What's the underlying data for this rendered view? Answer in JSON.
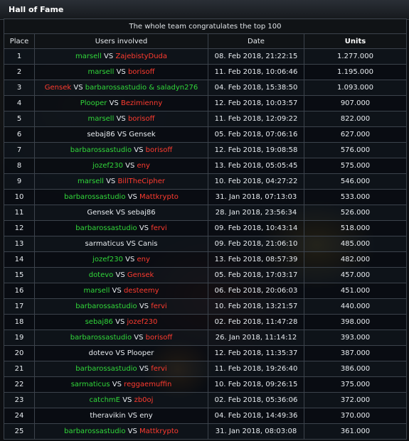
{
  "title": "Hall of Fame",
  "congrats": "The whole team congratulates the top 100",
  "columns": {
    "place": "Place",
    "users": "Users involved",
    "date": "Date",
    "units": "Units"
  },
  "colors": {
    "green": "#31d83a",
    "red": "#ff3b2f",
    "white": "#e8ecf0"
  },
  "vs": "VS",
  "rows": [
    {
      "place": "1",
      "a": "marsell",
      "ac": "p1",
      "b": "ZajebistyDuda",
      "bc": "p2",
      "date": "08. Feb 2018, 21:22:15",
      "units": "1.277.000"
    },
    {
      "place": "2",
      "a": "marsell",
      "ac": "p1",
      "b": "borisoff",
      "bc": "p2",
      "date": "11. Feb 2018, 10:06:46",
      "units": "1.195.000"
    },
    {
      "place": "3",
      "a": "Gensek",
      "ac": "p2",
      "b": "barbarossastudio & saladyn276",
      "bc": "p1",
      "date": "04. Feb 2018, 15:38:50",
      "units": "1.093.000"
    },
    {
      "place": "4",
      "a": "Plooper",
      "ac": "p1",
      "b": "Bezimienny",
      "bc": "p2",
      "date": "12. Feb 2018, 10:03:57",
      "units": "907.000"
    },
    {
      "place": "5",
      "a": "marsell",
      "ac": "p1",
      "b": "borisoff",
      "bc": "p2",
      "date": "11. Feb 2018, 12:09:22",
      "units": "822.000"
    },
    {
      "place": "6",
      "a": "sebaj86",
      "ac": "w",
      "b": "Gensek",
      "bc": "w",
      "date": "05. Feb 2018, 07:06:16",
      "units": "627.000"
    },
    {
      "place": "7",
      "a": "barbarossastudio",
      "ac": "p1",
      "b": "borisoff",
      "bc": "p2",
      "date": "12. Feb 2018, 19:08:58",
      "units": "576.000"
    },
    {
      "place": "8",
      "a": "jozef230",
      "ac": "p1",
      "b": "eny",
      "bc": "p2",
      "date": "13. Feb 2018, 05:05:45",
      "units": "575.000"
    },
    {
      "place": "9",
      "a": "marsell",
      "ac": "p1",
      "b": "BillTheCipher",
      "bc": "p2",
      "date": "10. Feb 2018, 04:27:22",
      "units": "546.000"
    },
    {
      "place": "10",
      "a": "barbarossastudio",
      "ac": "p1",
      "b": "Mattkrypto",
      "bc": "p2",
      "date": "31. Jan 2018, 07:13:03",
      "units": "533.000"
    },
    {
      "place": "11",
      "a": "Gensek",
      "ac": "w",
      "b": "sebaj86",
      "bc": "w",
      "date": "28. Jan 2018, 23:56:34",
      "units": "526.000"
    },
    {
      "place": "12",
      "a": "barbarossastudio",
      "ac": "p1",
      "b": "fervi",
      "bc": "p2",
      "date": "09. Feb 2018, 10:43:14",
      "units": "518.000"
    },
    {
      "place": "13",
      "a": "sarmaticus",
      "ac": "w",
      "b": "Canis",
      "bc": "w",
      "date": "09. Feb 2018, 21:06:10",
      "units": "485.000"
    },
    {
      "place": "14",
      "a": "jozef230",
      "ac": "p1",
      "b": "eny",
      "bc": "p2",
      "date": "13. Feb 2018, 08:57:39",
      "units": "482.000"
    },
    {
      "place": "15",
      "a": "dotevo",
      "ac": "p1",
      "b": "Gensek",
      "bc": "p2",
      "date": "05. Feb 2018, 17:03:17",
      "units": "457.000"
    },
    {
      "place": "16",
      "a": "marsell",
      "ac": "p1",
      "b": "desteemy",
      "bc": "p2",
      "date": "06. Feb 2018, 20:06:03",
      "units": "451.000"
    },
    {
      "place": "17",
      "a": "barbarossastudio",
      "ac": "p1",
      "b": "fervi",
      "bc": "p2",
      "date": "10. Feb 2018, 13:21:57",
      "units": "440.000"
    },
    {
      "place": "18",
      "a": "sebaj86",
      "ac": "p1",
      "b": "jozef230",
      "bc": "p2",
      "date": "02. Feb 2018, 11:47:28",
      "units": "398.000"
    },
    {
      "place": "19",
      "a": "barbarossastudio",
      "ac": "p1",
      "b": "borisoff",
      "bc": "p2",
      "date": "26. Jan 2018, 11:14:12",
      "units": "393.000"
    },
    {
      "place": "20",
      "a": "dotevo",
      "ac": "w",
      "b": "Plooper",
      "bc": "w",
      "date": "12. Feb 2018, 11:35:37",
      "units": "387.000"
    },
    {
      "place": "21",
      "a": "barbarossastudio",
      "ac": "p1",
      "b": "fervi",
      "bc": "p2",
      "date": "11. Feb 2018, 19:26:40",
      "units": "386.000"
    },
    {
      "place": "22",
      "a": "sarmaticus",
      "ac": "p1",
      "b": "reggaemuffin",
      "bc": "p2",
      "date": "10. Feb 2018, 09:26:15",
      "units": "375.000"
    },
    {
      "place": "23",
      "a": "catchmE",
      "ac": "p1",
      "b": "zb0oj",
      "bc": "p2",
      "date": "02. Feb 2018, 05:36:06",
      "units": "372.000"
    },
    {
      "place": "24",
      "a": "theravikin",
      "ac": "w",
      "b": "eny",
      "bc": "w",
      "date": "04. Feb 2018, 14:49:36",
      "units": "370.000"
    },
    {
      "place": "25",
      "a": "barbarossastudio",
      "ac": "p1",
      "b": "Mattkrypto",
      "bc": "p2",
      "date": "31. Jan 2018, 08:03:08",
      "units": "361.000"
    }
  ]
}
